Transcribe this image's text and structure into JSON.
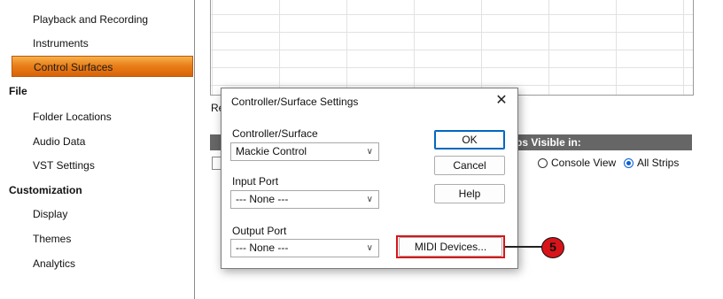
{
  "sidebar": {
    "items": [
      {
        "label": "Playback and Recording",
        "type": "item",
        "selected": false
      },
      {
        "label": "Instruments",
        "type": "item",
        "selected": false
      },
      {
        "label": "Control Surfaces",
        "type": "item",
        "selected": true
      },
      {
        "label": "File",
        "type": "category"
      },
      {
        "label": "Folder Locations",
        "type": "item",
        "selected": false
      },
      {
        "label": "Audio Data",
        "type": "item",
        "selected": false
      },
      {
        "label": "VST Settings",
        "type": "item",
        "selected": false
      },
      {
        "label": "Customization",
        "type": "category"
      },
      {
        "label": "Display",
        "type": "item",
        "selected": false
      },
      {
        "label": "Themes",
        "type": "item",
        "selected": false
      },
      {
        "label": "Analytics",
        "type": "item",
        "selected": false
      }
    ]
  },
  "background": {
    "label_partial": "Re",
    "strips_header": "trips Visible in:",
    "partial_option": "v",
    "options": [
      {
        "label": "Console View",
        "checked": false
      },
      {
        "label": "All Strips",
        "checked": true
      }
    ]
  },
  "dialog": {
    "title": "Controller/Surface Settings",
    "close_glyph": "✕",
    "controller_label": "Controller/Surface",
    "controller_value": "Mackie Control",
    "input_label": "Input Port",
    "input_value": "--- None ---",
    "output_label": "Output Port",
    "output_value": "--- None ---",
    "chevron_glyph": "∨",
    "buttons": {
      "ok": "OK",
      "cancel": "Cancel",
      "help": "Help",
      "midi_devices": "MIDI Devices..."
    }
  },
  "callout": {
    "number": "5",
    "color": "#d8141a"
  },
  "colors": {
    "selected_gradient_top": "#f7b24c",
    "selected_gradient_bottom": "#d96208",
    "header_bar": "#666666",
    "radio_accent": "#0a5fd6"
  }
}
